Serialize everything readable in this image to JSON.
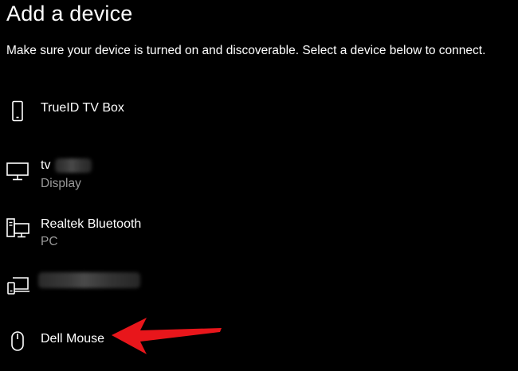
{
  "dialog": {
    "title": "Add a device",
    "instructions": "Make sure your device is turned on and discoverable. Select a device below to connect."
  },
  "devices": [
    {
      "name": "TrueID TV Box",
      "subtitle": "",
      "icon": "phone-icon"
    },
    {
      "name": "tv",
      "subtitle": "Display",
      "icon": "monitor-icon",
      "name_redacted": true
    },
    {
      "name": "Realtek Bluetooth",
      "subtitle": "PC",
      "icon": "pc-icon"
    },
    {
      "name": "",
      "subtitle": "",
      "icon": "laptop-phone-icon",
      "name_redacted": true
    },
    {
      "name": "Dell Mouse",
      "subtitle": "",
      "icon": "mouse-icon"
    }
  ],
  "annotation": {
    "arrow_color": "#e8161b",
    "points_to": "Dell Mouse"
  },
  "colors": {
    "background": "#000000",
    "text": "#ffffff",
    "subtext": "#9a9a9a"
  }
}
